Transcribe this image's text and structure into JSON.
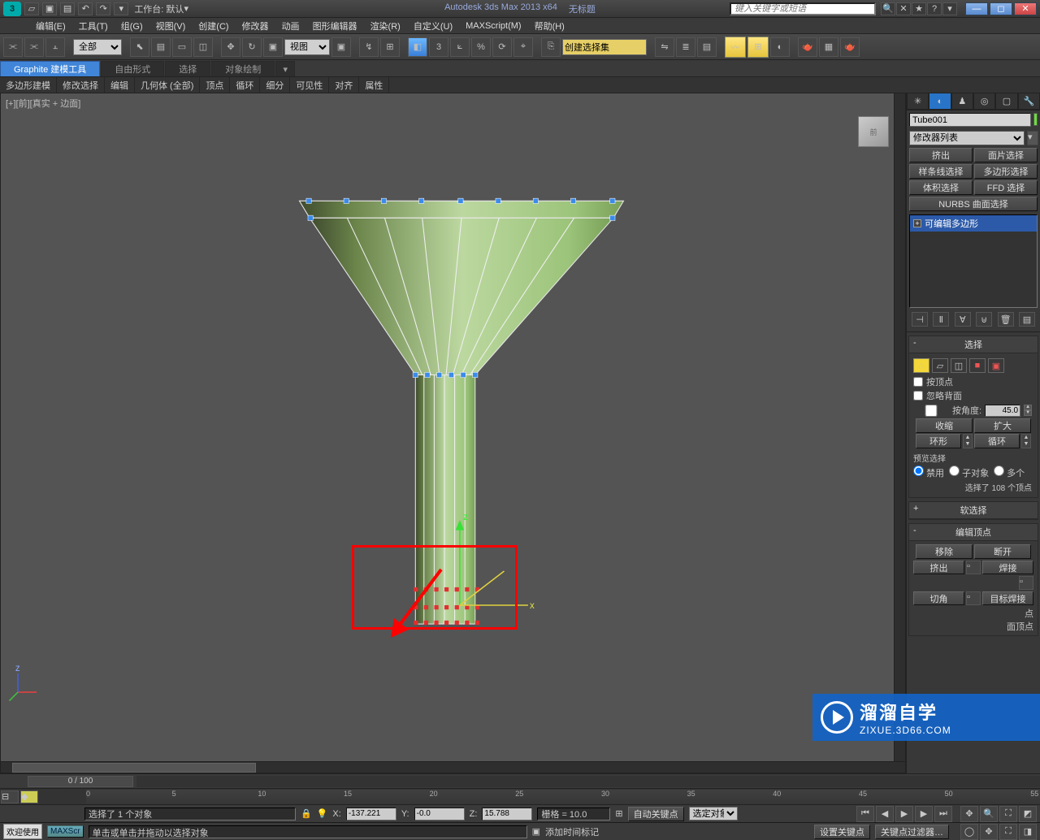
{
  "title": {
    "app": "Autodesk 3ds Max  2013 x64",
    "doc": "无标题",
    "workspace_label": "工作台: 默认",
    "search_placeholder": "键入关键字或短语"
  },
  "menu": [
    "编辑(E)",
    "工具(T)",
    "组(G)",
    "视图(V)",
    "创建(C)",
    "修改器",
    "动画",
    "图形编辑器",
    "渲染(R)",
    "自定义(U)",
    "MAXScript(M)",
    "帮助(H)"
  ],
  "toolbar": {
    "filter": "全部",
    "viewmode": "视图",
    "namedset": "创建选择集"
  },
  "ribbon": {
    "tabs": [
      "Graphite 建模工具",
      "自由形式",
      "选择",
      "对象绘制"
    ],
    "row2": [
      "多边形建模",
      "修改选择",
      "编辑",
      "几何体 (全部)",
      "顶点",
      "循环",
      "细分",
      "可见性",
      "对齐",
      "属性"
    ]
  },
  "viewport": {
    "label": "[+][前][真实 + 边面]",
    "cube": "前"
  },
  "panel": {
    "objname": "Tube001",
    "modlist": "修改器列表",
    "btns": {
      "extrude": "挤出",
      "facesel": "面片选择",
      "splinesel": "样条线选择",
      "polysel": "多边形选择",
      "volsel": "体积选择",
      "ffdsel": "FFD 选择",
      "nurbs": "NURBS 曲面选择"
    },
    "stack_item": "可编辑多边形",
    "rollouts": {
      "selection": "选择",
      "byvertex": "按顶点",
      "ignoreback": "忽略背面",
      "byangle": "按角度:",
      "angle": "45.0",
      "shrink": "收缩",
      "grow": "扩大",
      "ring": "环形",
      "loop": "循环",
      "preview": "预览选择",
      "disable": "禁用",
      "subobj": "子对象",
      "multi": "多个",
      "selinfo": "选择了 108 个顶点",
      "softsel": "软选择",
      "editvert": "编辑顶点",
      "remove": "移除",
      "break": "断开",
      "extrude2": "挤出",
      "weld": "焊接",
      "chamfer": "切角",
      "targetweld": "目标焊接",
      "point": "点",
      "tovert": "面顶点"
    }
  },
  "timeline": {
    "pos": "0 / 100",
    "ticks": [
      "0",
      "5",
      "10",
      "15",
      "20",
      "25",
      "30",
      "35",
      "40",
      "45",
      "50",
      "55"
    ]
  },
  "status": {
    "sel": "选择了 1 个对象",
    "x_lbl": "X:",
    "x": "-137.221",
    "y_lbl": "Y:",
    "y": "-0.0",
    "z_lbl": "Z:",
    "z": "15.788",
    "grid": "栅格 = 10.0",
    "autokey": "自动关键点",
    "selset": "选定对象",
    "hint": "单击或单击并拖动以选择对象",
    "addtime": "添加时间标记",
    "setkey": "设置关键点",
    "keyfilter": "关键点过滤器…"
  },
  "welcome": "欢迎使用",
  "maxscr": "MAXScr",
  "watermark": {
    "big": "溜溜自学",
    "url": "ZIXUE.3D66.COM"
  }
}
